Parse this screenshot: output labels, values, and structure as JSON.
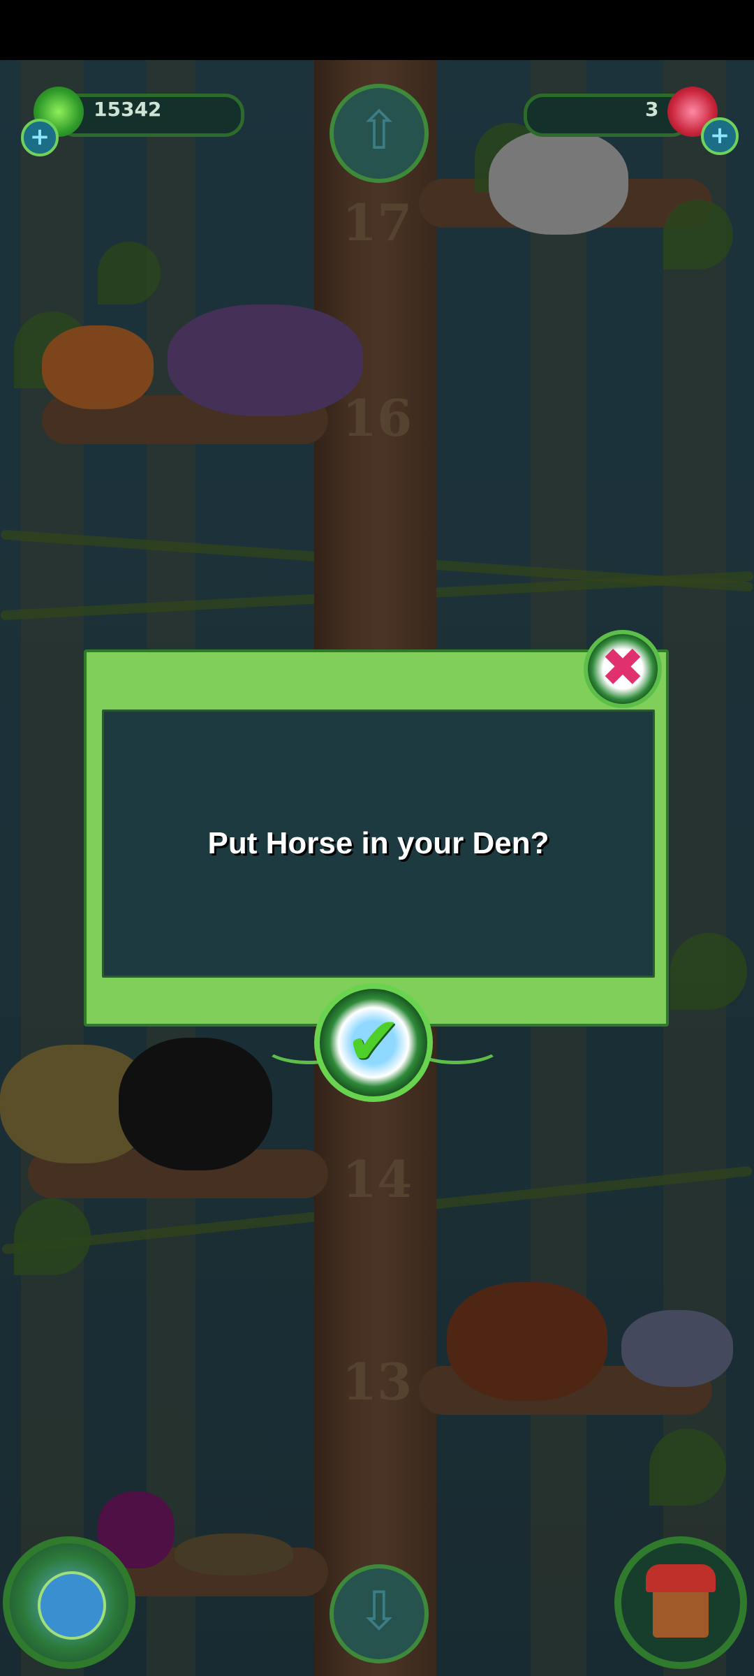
{
  "hud": {
    "gems_count": "15342",
    "tokens_count": "3",
    "add_gems_symbol": "+",
    "add_tokens_symbol": "+"
  },
  "tree": {
    "levels": [
      "17",
      "16",
      "14",
      "13"
    ]
  },
  "navigation": {
    "up_arrow": "⇧",
    "down_arrow": "⇩"
  },
  "dialog": {
    "message": "Put Horse in your Den?",
    "close_symbol": "✖",
    "confirm_symbol": "✔"
  },
  "colors": {
    "dialog_frame": "#7fcf5a",
    "dialog_panel": "#1d3a40",
    "close_accent": "#e0306e",
    "confirm_accent": "#4fcf2a"
  }
}
